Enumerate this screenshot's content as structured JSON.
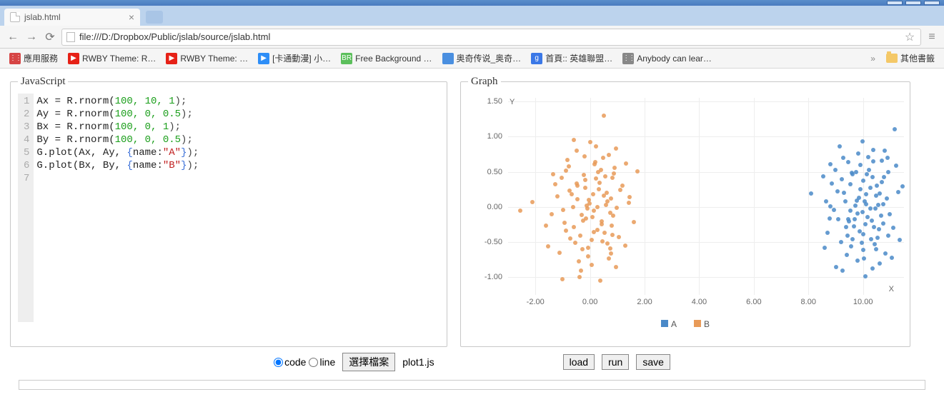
{
  "browser": {
    "tab_title": "jslab.html",
    "url": "file:///D:/Dropbox/Public/jslab/source/jslab.html"
  },
  "bookmarks": {
    "items": [
      {
        "label": "應用服務",
        "color": "#d64545",
        "kind": "grid"
      },
      {
        "label": "RWBY Theme: R…",
        "color": "#e62117",
        "kind": "yt"
      },
      {
        "label": "RWBY Theme: …",
        "color": "#e62117",
        "kind": "yt"
      },
      {
        "label": "[卡通動漫] 小…",
        "color": "#2e8ef7",
        "kind": "play"
      },
      {
        "label": "Free Background …",
        "color": "#5bbf5b",
        "kind": "tx",
        "tx": "BR"
      },
      {
        "label": "奥奇传说_奥奇…",
        "color": "#4a8fe0",
        "kind": "sq"
      },
      {
        "label": "首頁:: 英雄聯盟…",
        "color": "#3b78e7",
        "kind": "tx",
        "tx": "g"
      },
      {
        "label": "Anybody can lear…",
        "color": "#888888",
        "kind": "grid"
      }
    ],
    "overflow_folder": "其他書籤"
  },
  "panels": {
    "javascript_legend": "JavaScript",
    "graph_legend": "Graph"
  },
  "editor": {
    "lines": [
      {
        "n": 1,
        "t": "Ax = R.rnorm(",
        "a": "100, 10, 1",
        "e": ");"
      },
      {
        "n": 2,
        "t": "Ay = R.rnorm(",
        "a": "100, 0, 0.5",
        "e": ");"
      },
      {
        "n": 3,
        "t": "Bx = R.rnorm(",
        "a": "100, 0, 1",
        "e": ");"
      },
      {
        "n": 4,
        "t": "By = R.rnorm(",
        "a": "100, 0, 0.5",
        "e": ");"
      },
      {
        "n": 5,
        "t": "G.plot(Ax, Ay, ",
        "b": "{",
        "k": "name:",
        "s": "\"A\"",
        "bc": "}",
        "e": ");"
      },
      {
        "n": 6,
        "t": "G.plot(Bx, By, ",
        "b": "{",
        "k": "name:",
        "s": "\"B\"",
        "bc": "}",
        "e": ");"
      },
      {
        "n": 7,
        "t": "",
        "a": "",
        "e": ""
      }
    ]
  },
  "chart_data": {
    "type": "scatter",
    "xlabel": "X",
    "ylabel": "Y",
    "xlim": [
      -3,
      11.5
    ],
    "ylim": [
      -1.25,
      1.55
    ],
    "xticks": [
      -2.0,
      0.0,
      2.0,
      4.0,
      6.0,
      8.0,
      10.0
    ],
    "yticks": [
      -1.0,
      -0.5,
      0.0,
      0.5,
      1.0,
      1.5
    ],
    "series": [
      {
        "name": "A",
        "color": "#4a89c8",
        "points": [
          [
            9.45,
            -0.17
          ],
          [
            11.05,
            -0.72
          ],
          [
            8.11,
            0.19
          ],
          [
            10.07,
            0.08
          ],
          [
            10.38,
            0.65
          ],
          [
            9.58,
            0.48
          ],
          [
            10.09,
            -0.99
          ],
          [
            10.58,
            -0.32
          ],
          [
            10.08,
            -0.25
          ],
          [
            8.81,
            0.01
          ],
          [
            10.74,
            0.04
          ],
          [
            9.62,
            -0.46
          ],
          [
            9.76,
            0.09
          ],
          [
            9.61,
            0.46
          ],
          [
            10.68,
            0.66
          ],
          [
            9.81,
            -0.09
          ],
          [
            9.53,
            0.32
          ],
          [
            10.1,
            0.18
          ],
          [
            11.28,
            0.21
          ],
          [
            9.02,
            -0.85
          ],
          [
            10.97,
            -0.1
          ],
          [
            11.17,
            1.1
          ],
          [
            9.38,
            -0.29
          ],
          [
            11.45,
            0.29
          ],
          [
            8.66,
            0.08
          ],
          [
            9.06,
            0.22
          ],
          [
            10.93,
            0.49
          ],
          [
            9.09,
            -0.17
          ],
          [
            9.95,
            -0.51
          ],
          [
            10.36,
            0.42
          ],
          [
            10.01,
            0.37
          ],
          [
            9.67,
            -0.28
          ],
          [
            10.93,
            -0.41
          ],
          [
            10.77,
            0.42
          ],
          [
            10.04,
            -0.73
          ],
          [
            10.28,
            -0.02
          ],
          [
            11.1,
            -0.3
          ],
          [
            9.14,
            0.86
          ],
          [
            9.53,
            -0.05
          ],
          [
            9.19,
            -0.5
          ],
          [
            10.38,
            0.81
          ],
          [
            10.47,
            -0.6
          ],
          [
            10.46,
            -0.02
          ],
          [
            8.77,
            -0.16
          ],
          [
            8.8,
            0.61
          ],
          [
            9.82,
            0.76
          ],
          [
            9.31,
            0.2
          ],
          [
            10.75,
            -0.24
          ],
          [
            9.4,
            -0.68
          ],
          [
            9.74,
            0.49
          ],
          [
            10.53,
            -0.44
          ],
          [
            9.35,
            0.08
          ],
          [
            9.25,
            -0.9
          ],
          [
            10.89,
            0.7
          ],
          [
            10.16,
            -0.14
          ],
          [
            10.62,
            0.19
          ],
          [
            9.47,
            0.64
          ],
          [
            10.23,
            0.53
          ],
          [
            8.53,
            0.43
          ],
          [
            10.32,
            -0.19
          ],
          [
            9.91,
            0.25
          ],
          [
            10.2,
            0.71
          ],
          [
            8.7,
            -0.37
          ],
          [
            9.97,
            -0.07
          ],
          [
            10.5,
            0.3
          ],
          [
            9.69,
            -0.17
          ],
          [
            10.87,
            0.12
          ],
          [
            9.87,
            -0.35
          ],
          [
            10.43,
            -0.53
          ],
          [
            8.6,
            -0.58
          ],
          [
            11.21,
            0.59
          ],
          [
            10.56,
            0.03
          ],
          [
            9.23,
            0.39
          ],
          [
            10.3,
            -0.46
          ],
          [
            9.49,
            -0.21
          ],
          [
            10.65,
            -0.12
          ],
          [
            10.83,
            -0.66
          ],
          [
            9.9,
            0.6
          ],
          [
            10.7,
            0.35
          ],
          [
            9.79,
            -0.76
          ],
          [
            10.14,
            0.46
          ],
          [
            9.0,
            0.53
          ],
          [
            10.02,
            -0.39
          ],
          [
            10.6,
            -0.8
          ],
          [
            9.85,
            0.13
          ],
          [
            10.48,
            0.16
          ],
          [
            9.42,
            -0.41
          ],
          [
            10.26,
            0.27
          ],
          [
            8.93,
            -0.04
          ],
          [
            10.35,
            -0.87
          ],
          [
            9.97,
            0.93
          ],
          [
            10.8,
            0.8
          ],
          [
            11.34,
            -0.47
          ],
          [
            8.86,
            0.33
          ],
          [
            9.72,
            0.02
          ],
          [
            10.41,
            -0.29
          ],
          [
            9.56,
            -0.56
          ],
          [
            10.11,
            0.04
          ],
          [
            9.28,
            0.7
          ],
          [
            10.0,
            -0.61
          ]
        ]
      },
      {
        "name": "B",
        "color": "#e89a58",
        "points": [
          [
            -0.45,
            0.3
          ],
          [
            0.77,
            -0.66
          ],
          [
            -0.09,
            -0.02
          ],
          [
            0.31,
            0.49
          ],
          [
            -1.62,
            -0.27
          ],
          [
            0.98,
            -0.01
          ],
          [
            -0.21,
            0.72
          ],
          [
            1.42,
            0.06
          ],
          [
            0.05,
            -0.47
          ],
          [
            -0.74,
            0.23
          ],
          [
            0.58,
            0.03
          ],
          [
            -0.55,
            -0.51
          ],
          [
            0.17,
            0.61
          ],
          [
            -1.19,
            0.15
          ],
          [
            0.83,
            0.41
          ],
          [
            -0.34,
            -0.9
          ],
          [
            1.11,
            0.24
          ],
          [
            0.43,
            -0.2
          ],
          [
            -0.87,
            0.52
          ],
          [
            0.68,
            -0.73
          ],
          [
            -0.03,
            0.1
          ],
          [
            0.23,
            0.86
          ],
          [
            -1.4,
            -0.1
          ],
          [
            0.54,
            -0.37
          ],
          [
            -0.67,
            0.18
          ],
          [
            0.91,
            0.56
          ],
          [
            -0.14,
            -0.16
          ],
          [
            1.28,
            -0.55
          ],
          [
            -0.98,
            -0.04
          ],
          [
            0.36,
            0.34
          ],
          [
            -0.28,
            -0.6
          ],
          [
            0.78,
            0.12
          ],
          [
            0.07,
            -0.82
          ],
          [
            -1.05,
            0.41
          ],
          [
            0.48,
            0.7
          ],
          [
            -0.58,
            -0.29
          ],
          [
            0.85,
            -0.12
          ],
          [
            -0.22,
            0.45
          ],
          [
            1.05,
            -0.43
          ],
          [
            -0.82,
            0.67
          ],
          [
            0.14,
            -0.05
          ],
          [
            0.61,
            0.2
          ],
          [
            -0.39,
            -1.0
          ],
          [
            0.96,
            0.83
          ],
          [
            -2.1,
            0.07
          ],
          [
            0.28,
            -0.33
          ],
          [
            -0.72,
            -0.45
          ],
          [
            0.4,
            0.53
          ],
          [
            1.6,
            -0.22
          ],
          [
            -0.12,
            0.02
          ],
          [
            -0.49,
            0.8
          ],
          [
            0.73,
            -0.59
          ],
          [
            -1.27,
            0.32
          ],
          [
            0.1,
            -0.14
          ],
          [
            0.87,
            0.47
          ],
          [
            -0.06,
            -0.7
          ],
          [
            0.52,
            0.16
          ],
          [
            -0.93,
            -0.23
          ],
          [
            0.2,
            0.64
          ],
          [
            -0.35,
            -0.41
          ],
          [
            1.2,
            0.3
          ],
          [
            -0.63,
            0.0
          ],
          [
            0.46,
            -0.49
          ],
          [
            0.0,
            0.92
          ],
          [
            -1.53,
            -0.56
          ],
          [
            0.63,
            0.08
          ],
          [
            -0.17,
            0.38
          ],
          [
            0.74,
            -0.08
          ],
          [
            -0.42,
            -0.77
          ],
          [
            0.33,
            0.25
          ],
          [
            0.13,
            -0.36
          ],
          [
            -0.77,
            0.58
          ],
          [
            1.46,
            0.14
          ],
          [
            -0.24,
            -0.19
          ],
          [
            0.57,
            0.43
          ],
          [
            -1.12,
            -0.65
          ],
          [
            0.8,
            -0.27
          ],
          [
            -0.02,
            0.05
          ],
          [
            0.38,
            -1.05
          ],
          [
            -0.5,
            0.33
          ],
          [
            0.69,
            0.74
          ],
          [
            -0.89,
            -0.34
          ],
          [
            0.26,
            0.0
          ],
          [
            1.73,
            0.51
          ],
          [
            -0.31,
            -0.11
          ],
          [
            0.94,
            -0.85
          ],
          [
            -1.34,
            0.46
          ],
          [
            0.11,
            0.18
          ],
          [
            0.44,
            -0.25
          ],
          [
            -0.6,
            0.95
          ],
          [
            0.82,
            -0.4
          ],
          [
            -0.18,
            0.27
          ],
          [
            0.5,
            1.3
          ],
          [
            -2.55,
            -0.05
          ],
          [
            0.65,
            -0.52
          ],
          [
            -0.46,
            0.11
          ],
          [
            1.33,
            0.62
          ],
          [
            -0.08,
            -0.58
          ],
          [
            0.21,
            0.4
          ],
          [
            -1.0,
            -1.03
          ]
        ]
      }
    ]
  },
  "controls": {
    "radio_code": "code",
    "radio_line": "line",
    "choose_file": "選擇檔案",
    "filename": "plot1.js",
    "load": "load",
    "run": "run",
    "save": "save"
  }
}
